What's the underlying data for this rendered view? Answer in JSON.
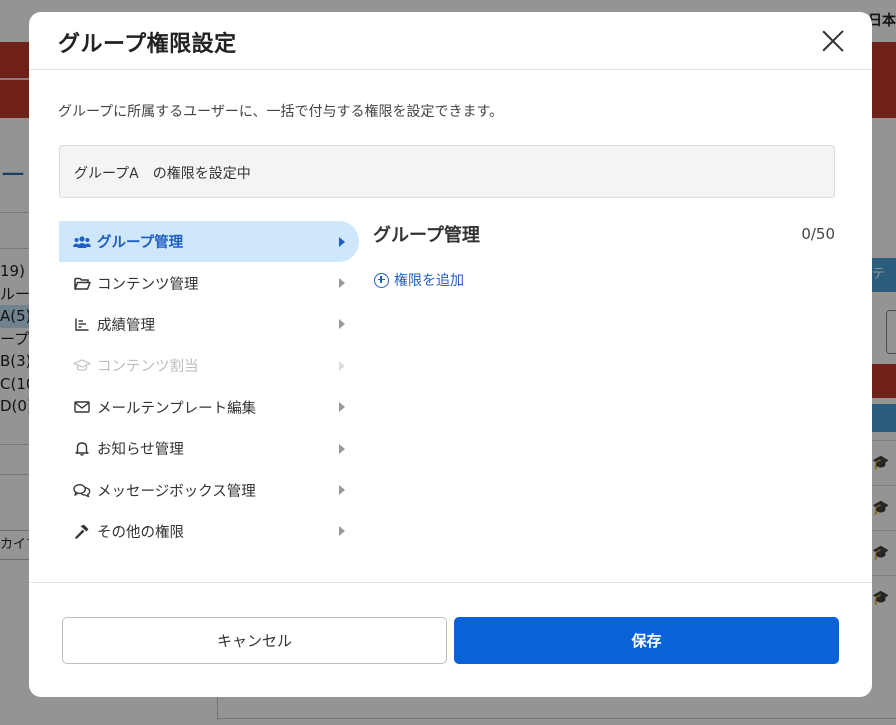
{
  "background": {
    "language": "日本",
    "heading": "ー ソ",
    "side_items": [
      "19)",
      "ルー",
      "A(5)",
      "ープA",
      "B(3)",
      "C(10",
      "D(0)"
    ],
    "left_caption": "カイブ",
    "right_tab": "テン"
  },
  "modal": {
    "title": "グループ権限設定",
    "description": "グループに所属するユーザーに、一括で付与する権限を設定できます。",
    "status_text": "グループA　の権限を設定中"
  },
  "menu": {
    "items": [
      {
        "label": "グループ管理",
        "icon": "users-icon",
        "state": "active"
      },
      {
        "label": "コンテンツ管理",
        "icon": "folder-open-icon",
        "state": "normal"
      },
      {
        "label": "成績管理",
        "icon": "chart-icon",
        "state": "normal"
      },
      {
        "label": "コンテンツ割当",
        "icon": "graduation-cap-icon",
        "state": "disabled"
      },
      {
        "label": "メールテンプレート編集",
        "icon": "envelope-icon",
        "state": "normal"
      },
      {
        "label": "お知らせ管理",
        "icon": "bell-icon",
        "state": "normal"
      },
      {
        "label": "メッセージボックス管理",
        "icon": "comments-icon",
        "state": "normal"
      },
      {
        "label": "その他の権限",
        "icon": "hammer-icon",
        "state": "normal"
      }
    ]
  },
  "panel": {
    "title": "グループ管理",
    "count": "0/50",
    "add_label": "権限を追加"
  },
  "footer": {
    "cancel_label": "キャンセル",
    "save_label": "保存"
  },
  "colors": {
    "accent": "#0a63d6",
    "active_bg": "#cfe7fa",
    "active_text": "#1f5fbf",
    "header_red": "#c0392b"
  }
}
